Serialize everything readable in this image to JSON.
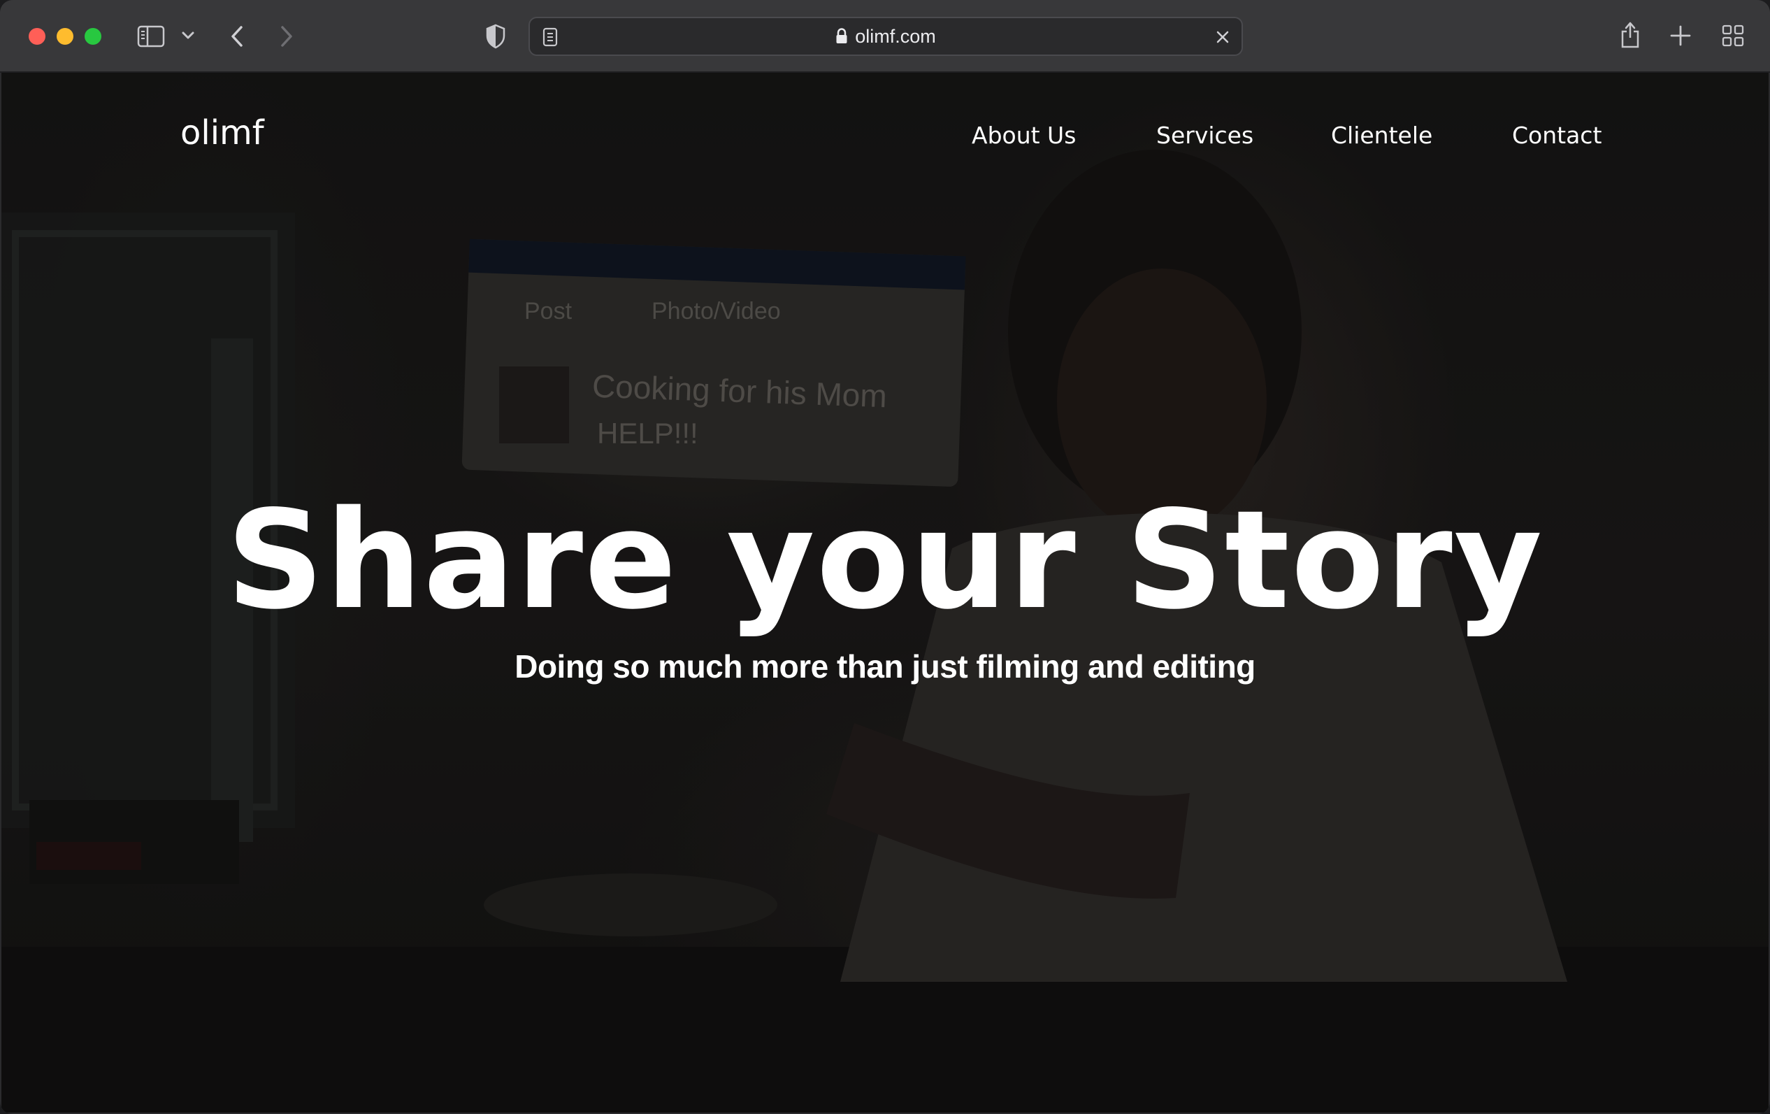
{
  "browser": {
    "url": "olimf.com",
    "colors": {
      "close": "#ff5f57",
      "minimize": "#febc2e",
      "zoom": "#28c840"
    }
  },
  "site": {
    "logo": "olimf",
    "nav": [
      "About Us",
      "Services",
      "Clientele",
      "Contact"
    ],
    "hero": {
      "title": "Share your Story",
      "subtitle": "Doing so much more than just filming and editing"
    },
    "background_screen": {
      "post_label": "Post",
      "photo_label": "Photo/Video",
      "line1": "Cooking for his Mom",
      "line2": "HELP!!!"
    }
  }
}
